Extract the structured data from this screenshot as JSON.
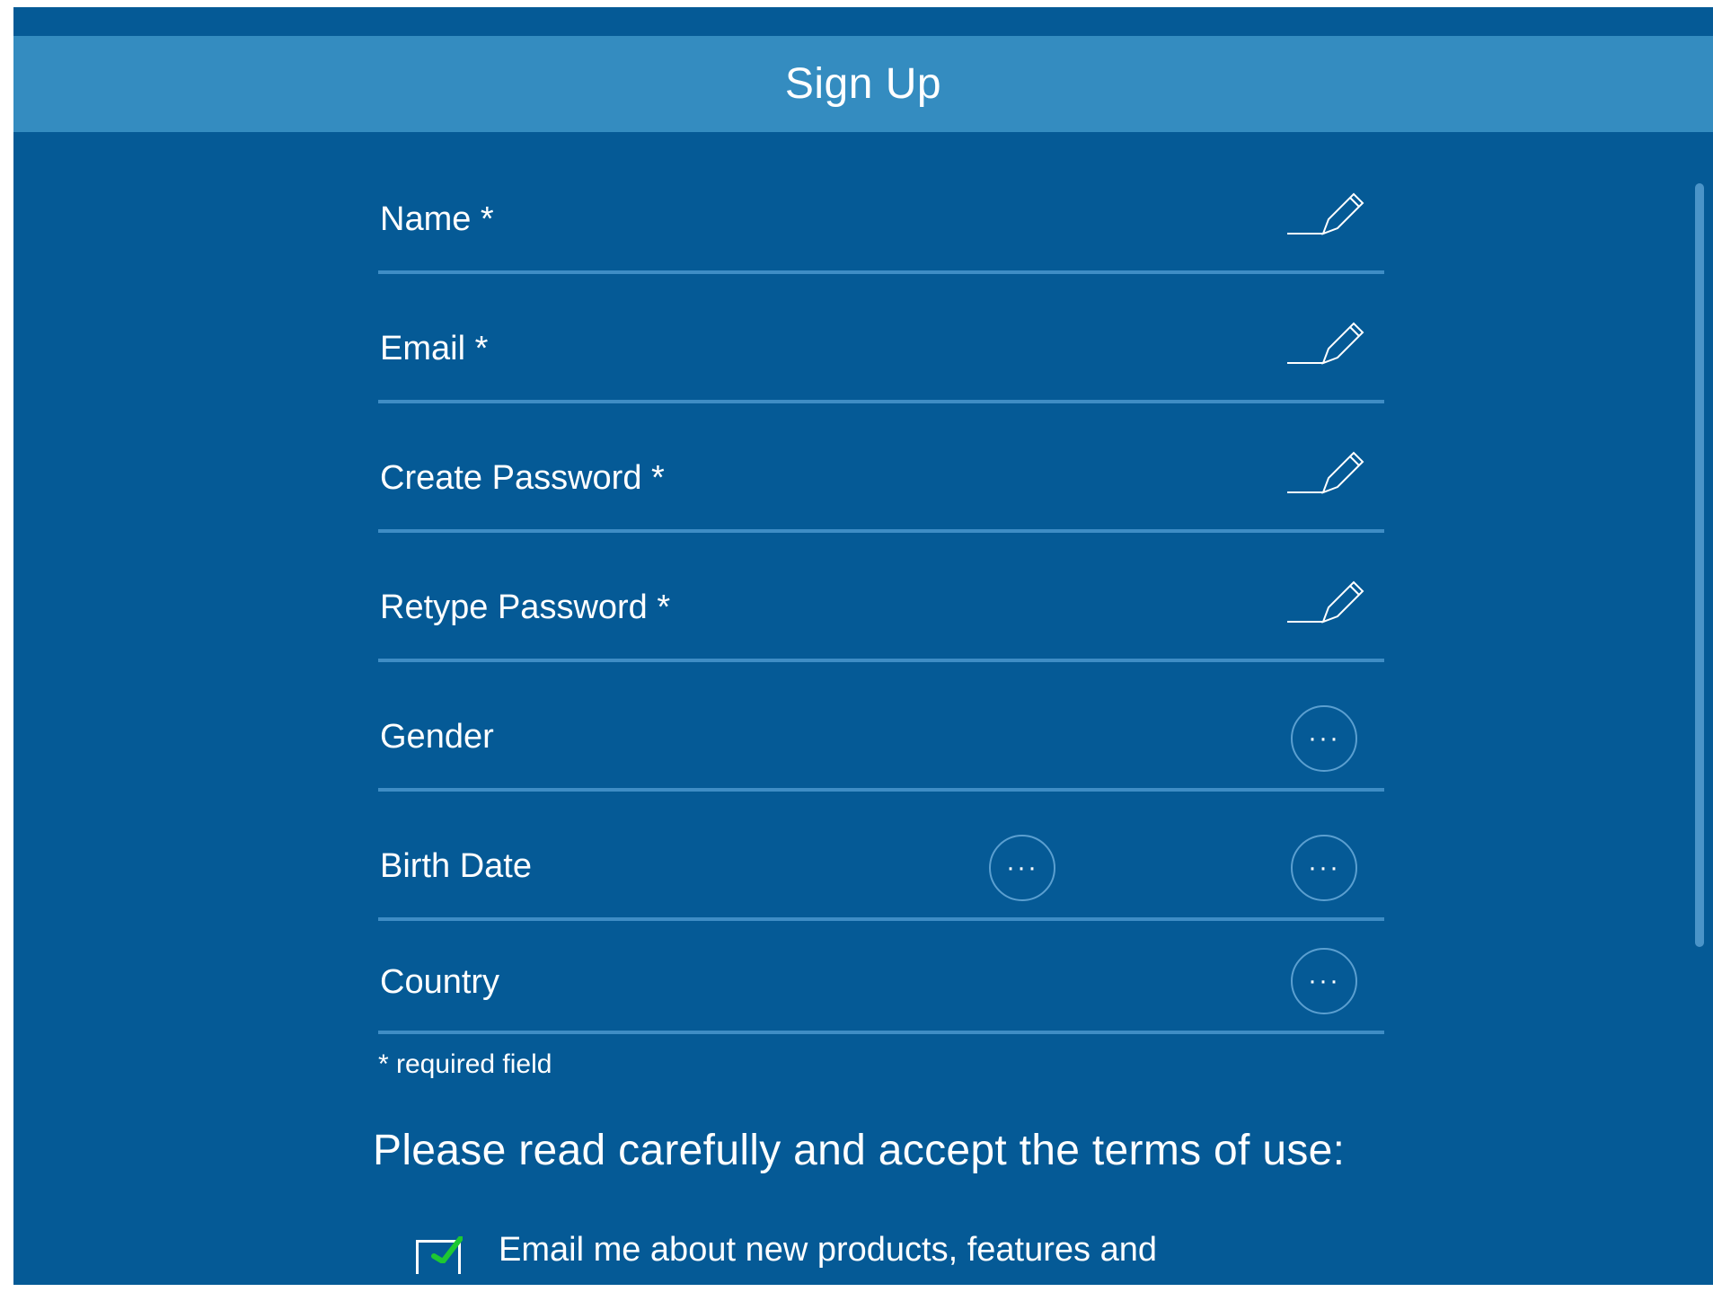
{
  "header": {
    "title": "Sign Up"
  },
  "form": {
    "fields": [
      {
        "label": "Name *",
        "control": "edit"
      },
      {
        "label": "Email *",
        "control": "edit"
      },
      {
        "label": "Create Password *",
        "control": "edit"
      },
      {
        "label": "Retype Password *",
        "control": "edit"
      },
      {
        "label": "Gender",
        "control": "more"
      },
      {
        "label": "Birth Date",
        "control": "more-two"
      },
      {
        "label": "Country",
        "control": "more"
      }
    ],
    "more_glyph": "···",
    "hint": "* required field"
  },
  "terms": {
    "heading": "Please read carefully and accept the terms of use:",
    "options": [
      {
        "label": "Email me about new products, features and",
        "checked": true
      }
    ]
  },
  "colors": {
    "background": "#055a96",
    "header": "#348cc0",
    "divider": "#3f8dc5",
    "check": "#1ec832"
  },
  "icons": {
    "edit": "pencil-icon",
    "more": "ellipsis-icon",
    "check": "checkmark-icon"
  }
}
